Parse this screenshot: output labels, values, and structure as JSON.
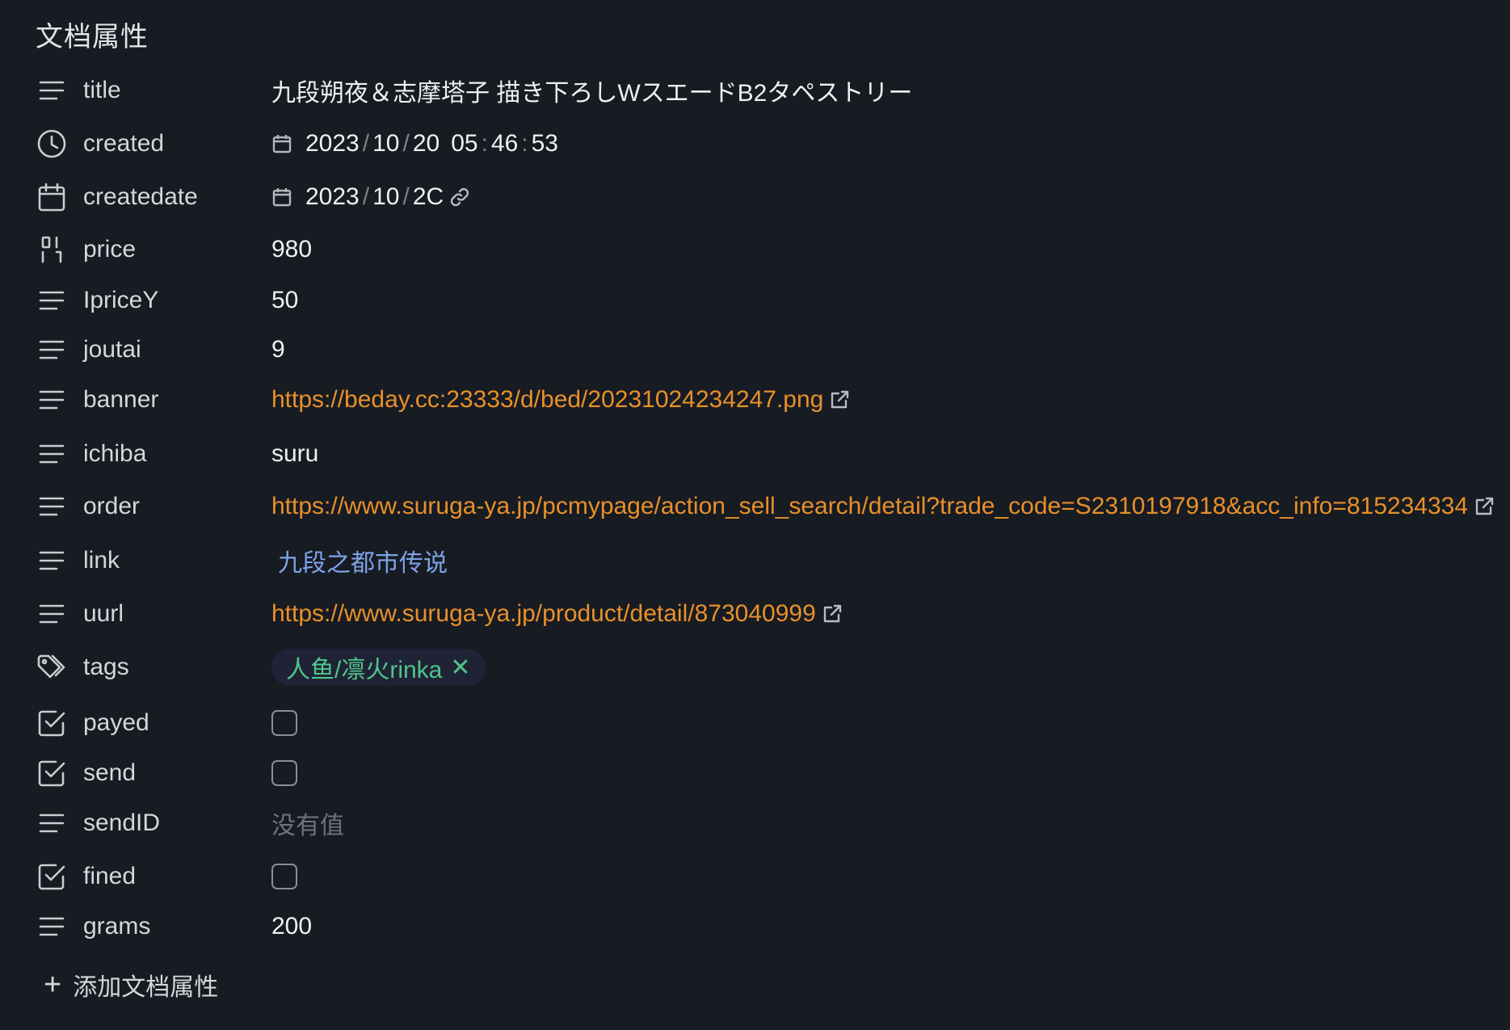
{
  "panel": {
    "heading": "文档属性",
    "add_label": "添加文档属性"
  },
  "properties": [
    {
      "key": "title",
      "icon": "text-lines-icon",
      "value": "九段朔夜＆志摩塔子 描き下ろしWスエードB2タペストリー"
    },
    {
      "key": "created",
      "icon": "clock-icon",
      "date": [
        "2023",
        "10",
        "20"
      ],
      "time": [
        "05",
        "46",
        "53"
      ]
    },
    {
      "key": "createdate",
      "icon": "calendar-icon",
      "date": [
        "2023",
        "10",
        "2C"
      ]
    },
    {
      "key": "price",
      "icon": "number-icon",
      "value": "980"
    },
    {
      "key": "IpriceY",
      "icon": "text-lines-icon",
      "value": "50"
    },
    {
      "key": "joutai",
      "icon": "text-lines-icon",
      "value": "9"
    },
    {
      "key": "banner",
      "icon": "text-lines-icon",
      "value": "https://beday.cc:23333/d/bed/20231024234247.png"
    },
    {
      "key": "ichiba",
      "icon": "text-lines-icon",
      "value": "suru"
    },
    {
      "key": "order",
      "icon": "text-lines-icon",
      "value": "https://www.suruga-ya.jp/pcmypage/action_sell_search/detail?trade_code=S2310197918&acc_info=815234334"
    },
    {
      "key": "link",
      "icon": "text-lines-icon",
      "value": "九段之都市传说"
    },
    {
      "key": "uurl",
      "icon": "text-lines-icon",
      "value": "https://www.suruga-ya.jp/product/detail/873040999"
    },
    {
      "key": "tags",
      "icon": "tags-icon",
      "value": "人鱼/凛火rinka"
    },
    {
      "key": "payed",
      "icon": "checkbox-icon",
      "checked": false
    },
    {
      "key": "send",
      "icon": "checkbox-icon",
      "checked": false
    },
    {
      "key": "sendID",
      "icon": "text-lines-icon",
      "value": "没有值"
    },
    {
      "key": "fined",
      "icon": "checkbox-icon",
      "checked": false
    },
    {
      "key": "grams",
      "icon": "text-lines-icon",
      "value": "200"
    }
  ],
  "colors": {
    "background": "#171b22",
    "link": "#e8902a",
    "internal_link": "#7ea3e8",
    "tag_text": "#4fc489",
    "tag_bg": "#1f2335",
    "placeholder": "#6e7279"
  }
}
